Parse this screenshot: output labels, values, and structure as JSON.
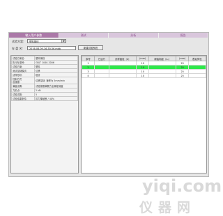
{
  "tabs": [
    {
      "label": "输入用户参数",
      "active": true
    },
    {
      "label": "测试",
      "active": false
    },
    {
      "label": "分析",
      "active": false
    },
    {
      "label": "报告",
      "active": false
    }
  ],
  "toolbar": {
    "scheme_label": "试验方案:",
    "scheme_value": "塑料钢线",
    "file_label": "存 盘 名:",
    "file_value": "2016-08-09-16-50-56.mdb",
    "new_button": "新建试验系统"
  },
  "params": [
    {
      "k": "试验方案名:",
      "v": "塑料钢线"
    },
    {
      "k": "执行标准号:",
      "v": "GB/T 1040-2006"
    },
    {
      "k": "试验方案:",
      "v": "塑料"
    },
    {
      "k": "测试控制模式:",
      "v": "位移"
    },
    {
      "k": "试样形状:",
      "v": "哑铃"
    },
    {
      "k": "控制方式\n及速度:",
      "v": "位移控制; 速率为 5mm/min",
      "tall": true
    },
    {
      "k": "满度设置:",
      "v": "试验按照满载力全量程测度"
    },
    {
      "k": "力阶点:",
      "v": "2 kN"
    },
    {
      "k": "试验次数:",
      "v": "5"
    },
    {
      "k": "试验结果条件:",
      "v": "扣力降破断 / 40%"
    }
  ],
  "grid": {
    "headers": [
      "序号",
      "已运行",
      "试样直径（d）",
      "(mm)",
      "原始标距（L₀）",
      "(mm)",
      "断后伸长"
    ],
    "rows": [
      [
        "1",
        "",
        "",
        "10",
        "",
        "25",
        ""
      ],
      [
        "2",
        "",
        "",
        "10",
        "",
        "25",
        ""
      ],
      [
        "3",
        "",
        "",
        "10",
        "",
        "25",
        ""
      ],
      [
        "4",
        "",
        "",
        "10",
        "",
        "25",
        ""
      ]
    ],
    "selected_row": 1
  },
  "watermark": {
    "line1": "yiqi.com",
    "line2": "仪器网"
  },
  "colors": {
    "tab_active": "#ab79a8",
    "tab": "#d9c6dc",
    "selection": "#2ee84a"
  }
}
